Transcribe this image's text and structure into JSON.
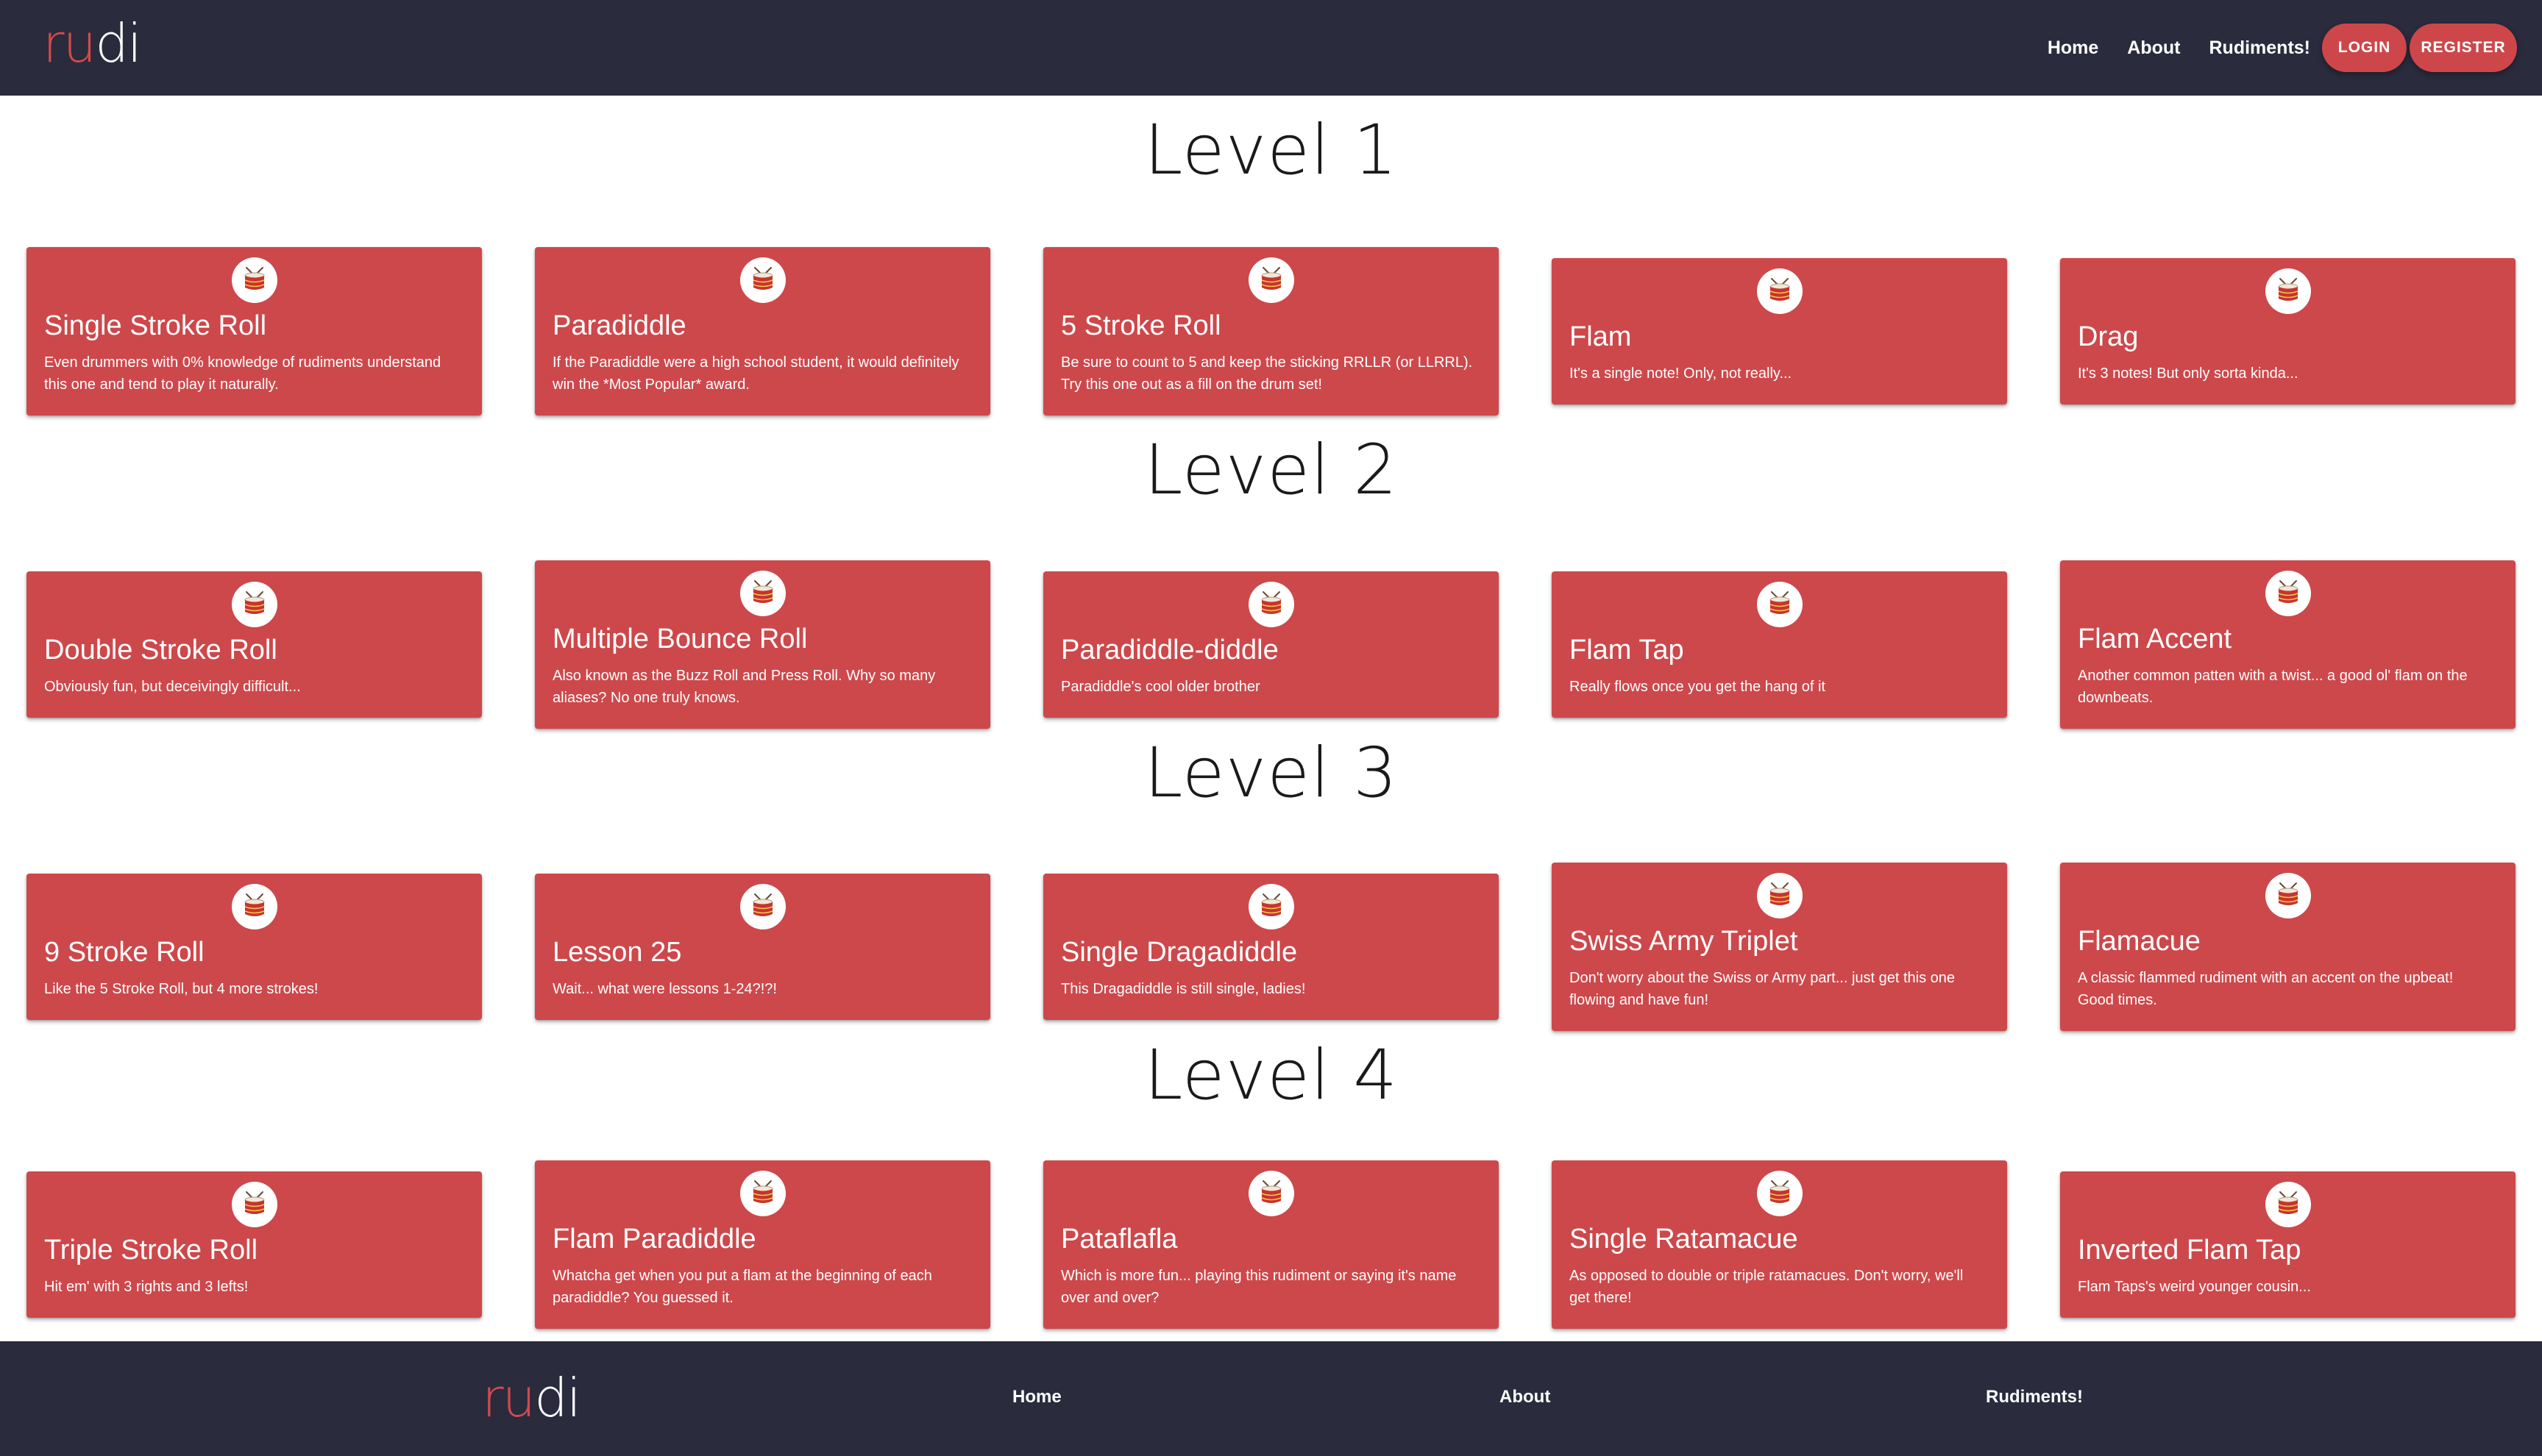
{
  "brand": {
    "logo_left": "ru",
    "logo_right": "di"
  },
  "nav": {
    "home": "Home",
    "about": "About",
    "rudiments": "Rudiments!",
    "login": "LOGIN",
    "register": "REGISTER"
  },
  "levels": [
    {
      "title": "Level 1",
      "cards": [
        {
          "title": "Single Stroke Roll",
          "desc": "Even drummers with 0% knowledge of rudiments understand this one and tend to play it naturally."
        },
        {
          "title": "Paradiddle",
          "desc": "If the Paradiddle were a high school student, it would definitely win the *Most Popular* award."
        },
        {
          "title": "5 Stroke Roll",
          "desc": "Be sure to count to 5 and keep the sticking RRLLR (or LLRRL). Try this one out as a fill on the drum set!"
        },
        {
          "title": "Flam",
          "desc": "It's a single note! Only, not really..."
        },
        {
          "title": "Drag",
          "desc": "It's 3 notes! But only sorta kinda..."
        }
      ]
    },
    {
      "title": "Level 2",
      "cards": [
        {
          "title": "Double Stroke Roll",
          "desc": "Obviously fun, but deceivingly difficult..."
        },
        {
          "title": "Multiple Bounce Roll",
          "desc": "Also known as the Buzz Roll and Press Roll. Why so many aliases? No one truly knows."
        },
        {
          "title": "Paradiddle-diddle",
          "desc": "Paradiddle's cool older brother"
        },
        {
          "title": "Flam Tap",
          "desc": "Really flows once you get the hang of it"
        },
        {
          "title": "Flam Accent",
          "desc": "Another common patten with a twist... a good ol' flam on the downbeats."
        }
      ]
    },
    {
      "title": "Level 3",
      "cards": [
        {
          "title": "9 Stroke Roll",
          "desc": "Like the 5 Stroke Roll, but 4 more strokes!"
        },
        {
          "title": "Lesson 25",
          "desc": "Wait... what were lessons 1-24?!?!"
        },
        {
          "title": "Single Dragadiddle",
          "desc": "This Dragadiddle is still single, ladies!"
        },
        {
          "title": "Swiss Army Triplet",
          "desc": "Don't worry about the Swiss or Army part... just get this one flowing and have fun!"
        },
        {
          "title": "Flamacue",
          "desc": "A classic flammed rudiment with an accent on the upbeat! Good times."
        }
      ]
    },
    {
      "title": "Level 4",
      "cards": [
        {
          "title": "Triple Stroke Roll",
          "desc": "Hit em' with 3 rights and 3 lefts!"
        },
        {
          "title": "Flam Paradiddle",
          "desc": "Whatcha get when you put a flam at the beginning of each paradiddle? You guessed it."
        },
        {
          "title": "Pataflafla",
          "desc": "Which is more fun... playing this rudiment or saying it's name over and over?"
        },
        {
          "title": "Single Ratamacue",
          "desc": "As opposed to double or triple ratamacues. Don't worry, we'll get there!"
        },
        {
          "title": "Inverted Flam Tap",
          "desc": "Flam Taps's weird younger cousin..."
        }
      ]
    }
  ],
  "footer": {
    "home": "Home",
    "about": "About",
    "rudiments": "Rudiments!"
  },
  "icons": {
    "card_icon": "drum-icon"
  },
  "colors": {
    "navbar": "#2a2b3d",
    "card": "#cd484b",
    "accent": "#d24a4c"
  }
}
